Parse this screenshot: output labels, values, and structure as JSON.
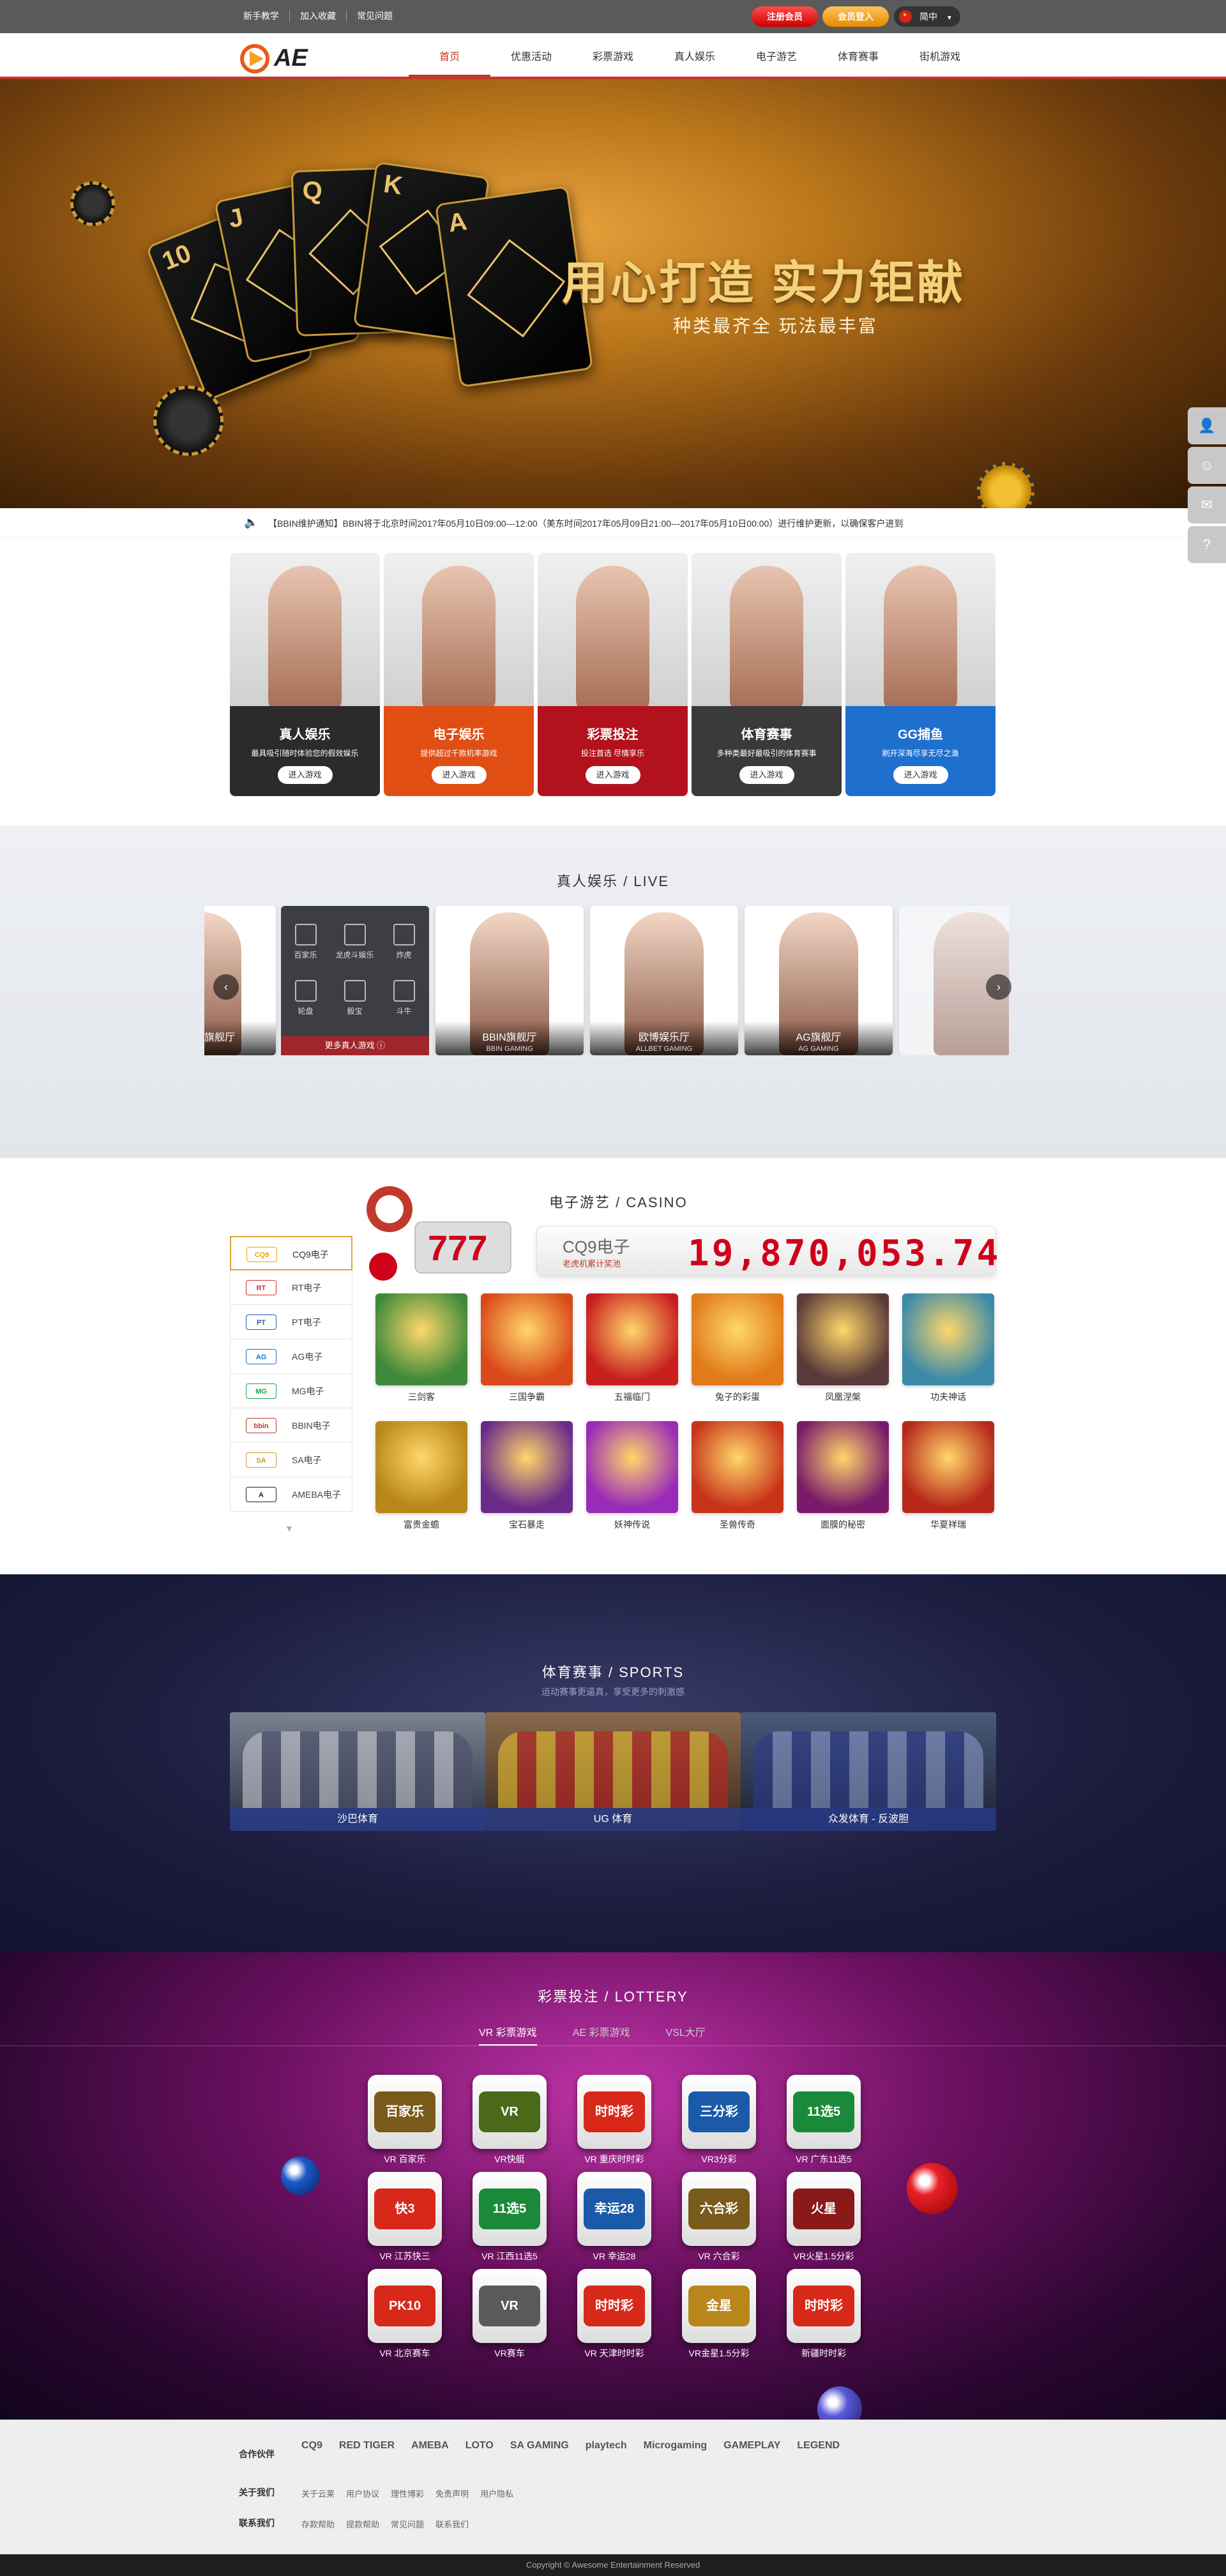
{
  "topbar": {
    "links": [
      "新手教学",
      "加入收藏",
      "常见问题"
    ],
    "register": "注册会员",
    "login": "会员登入",
    "language": "简中"
  },
  "nav": {
    "logo_text": "AE",
    "items": [
      "首页",
      "优惠活动",
      "彩票游戏",
      "真人娱乐",
      "电子游艺",
      "体育赛事",
      "街机游戏"
    ],
    "active_index": 0
  },
  "banner": {
    "title": "用心打造 实力钜献",
    "subtitle": "种类最齐全  玩法最丰富",
    "cards": [
      "10",
      "J",
      "Q",
      "K",
      "A"
    ]
  },
  "notice": {
    "text": "【BBIN维护通知】BBIN将于北京时间2017年05月10日09:00---12:00（美东时间2017年05月09日21:00---2017年05月10日00:00）进行维护更新，以确保客户进到"
  },
  "categories": [
    {
      "title": "真人娱乐",
      "desc": "最具吸引随时体验您的假效娱乐",
      "button": "进入游戏",
      "color": "#2b2b2b"
    },
    {
      "title": "电子娱乐",
      "desc": "提供超过千款机率游戏",
      "button": "进入游戏",
      "color": "#e04e14"
    },
    {
      "title": "彩票投注",
      "desc": "投注首选 尽情享乐",
      "button": "进入游戏",
      "color": "#b3121c"
    },
    {
      "title": "体育赛事",
      "desc": "多种类最好最吸引的体育赛事",
      "button": "进入游戏",
      "color": "#3a3a3a"
    },
    {
      "title": "GG捕鱼",
      "desc": "刷开深海尽享无尽之渔",
      "button": "进入游戏",
      "color": "#1f6fcf"
    }
  ],
  "live": {
    "title": "真人娱乐 / LIVE",
    "menu_items": [
      "百家乐",
      "龙虎斗娱乐",
      "炸虎",
      "轮盘",
      "骰宝",
      "斗牛"
    ],
    "menu_more": "更多真人游戏",
    "tiles": [
      {
        "name": "BBIN旗舰厅",
        "sub": "BBIN GAMING"
      },
      {
        "name": "欧博娱乐厅",
        "sub": "ALLBET GAMING"
      },
      {
        "name": "AG旗舰厅",
        "sub": "AG GAMING"
      }
    ],
    "left_partial": "旗舰厅",
    "prev": "‹",
    "next": "›"
  },
  "casino": {
    "title": "电子游艺 / CASINO",
    "jackpot_name": "CQ9电子",
    "jackpot_note": "老虎机累计奖池",
    "jackpot_value": "19,870,053.74",
    "providers": [
      {
        "name": "CQ9电子",
        "logo": "CQ9",
        "color": "#e8a500"
      },
      {
        "name": "RT电子",
        "logo": "RT",
        "color": "#d9302a"
      },
      {
        "name": "PT电子",
        "logo": "PT",
        "color": "#2a56b8"
      },
      {
        "name": "AG电子",
        "logo": "AG",
        "color": "#1d6fd1"
      },
      {
        "name": "MG电子",
        "logo": "MG",
        "color": "#1fa14a"
      },
      {
        "name": "BBIN电子",
        "logo": "bbin",
        "color": "#c0392b"
      },
      {
        "name": "SA电子",
        "logo": "SA",
        "color": "#c89a30"
      },
      {
        "name": "AMEBA电子",
        "logo": "A",
        "color": "#222"
      }
    ],
    "games": [
      {
        "name": "三剑客",
        "color": "#3f8a3a"
      },
      {
        "name": "三国争霸",
        "color": "#d94a1a"
      },
      {
        "name": "五福临门",
        "color": "#c81e1e"
      },
      {
        "name": "兔子的彩蛋",
        "color": "#e07a1a"
      },
      {
        "name": "凤凰涅槃",
        "color": "#5a3a3a"
      },
      {
        "name": "功夫神话",
        "color": "#3a8aa8"
      },
      {
        "name": "富贵金蟾",
        "color": "#b8861a"
      },
      {
        "name": "宝石暴走",
        "color": "#6a2a8a"
      },
      {
        "name": "妖神传说",
        "color": "#9a2ab8"
      },
      {
        "name": "圣兽传奇",
        "color": "#c8341a"
      },
      {
        "name": "面膜的秘密",
        "color": "#7a1a6a"
      },
      {
        "name": "华夏祥瑞",
        "color": "#b8281a"
      }
    ]
  },
  "sports": {
    "title": "体育赛事 / SPORTS",
    "note": "运动赛事更逼真，享受更多的刺激感",
    "tiles": [
      "沙巴体育",
      "UG 体育",
      "众发体育 - 反波胆"
    ]
  },
  "lottery": {
    "title": "彩票投注 / LOTTERY",
    "tabs": [
      "VR 彩票游戏",
      "AE 彩票游戏",
      "VSL大厅"
    ],
    "active_tab": 0,
    "items": [
      {
        "name": "VR 百家乐",
        "icon": "百家乐",
        "color": "#7a5a1a"
      },
      {
        "name": "VR快艇",
        "icon": "VR",
        "color": "#4a6a1a"
      },
      {
        "name": "VR 重庆时时彩",
        "icon": "时时彩",
        "color": "#d8281a"
      },
      {
        "name": "VR3分彩",
        "icon": "三分彩",
        "color": "#1a5aa8"
      },
      {
        "name": "VR 广东11选5",
        "icon": "11选5",
        "color": "#1a8a3a"
      },
      {
        "name": "VR 江苏快三",
        "icon": "快3",
        "color": "#d8281a"
      },
      {
        "name": "VR 江西11选5",
        "icon": "11选5",
        "color": "#1a8a3a"
      },
      {
        "name": "VR 幸运28",
        "icon": "幸运28",
        "color": "#1a5aa8"
      },
      {
        "name": "VR 六合彩",
        "icon": "六合彩",
        "color": "#7a5a1a"
      },
      {
        "name": "VR火星1.5分彩",
        "icon": "火星",
        "color": "#8a1a1a"
      },
      {
        "name": "VR 北京赛车",
        "icon": "PK10",
        "color": "#d8281a"
      },
      {
        "name": "VR赛车",
        "icon": "VR",
        "color": "#5a5a5a"
      },
      {
        "name": "VR 天津时时彩",
        "icon": "时时彩",
        "color": "#d8281a"
      },
      {
        "name": "VR金星1.5分彩",
        "icon": "金星",
        "color": "#b8861a"
      },
      {
        "name": "新疆时时彩",
        "icon": "时时彩",
        "color": "#d8281a"
      }
    ]
  },
  "footer": {
    "partners_label": "合作伙伴",
    "partners": [
      "CQ9",
      "RED TIGER",
      "AMEBA",
      "LOTO",
      "SA GAMING",
      "playtech",
      "Microgaming",
      "GAMEPLAY",
      "LEGEND"
    ],
    "about_label": "关于我们",
    "about_links": [
      "关于云莱",
      "用户协议",
      "理性博彩",
      "免责声明",
      "用户隐私"
    ],
    "contact_label": "联系我们",
    "contact_links": [
      "存款帮助",
      "提款帮助",
      "常见问题",
      "联系我们"
    ],
    "copyright": "Copyright © Awesome Entertainment Reserved"
  },
  "side": [
    "user-icon",
    "qq-icon",
    "mail-icon",
    "help-icon"
  ]
}
